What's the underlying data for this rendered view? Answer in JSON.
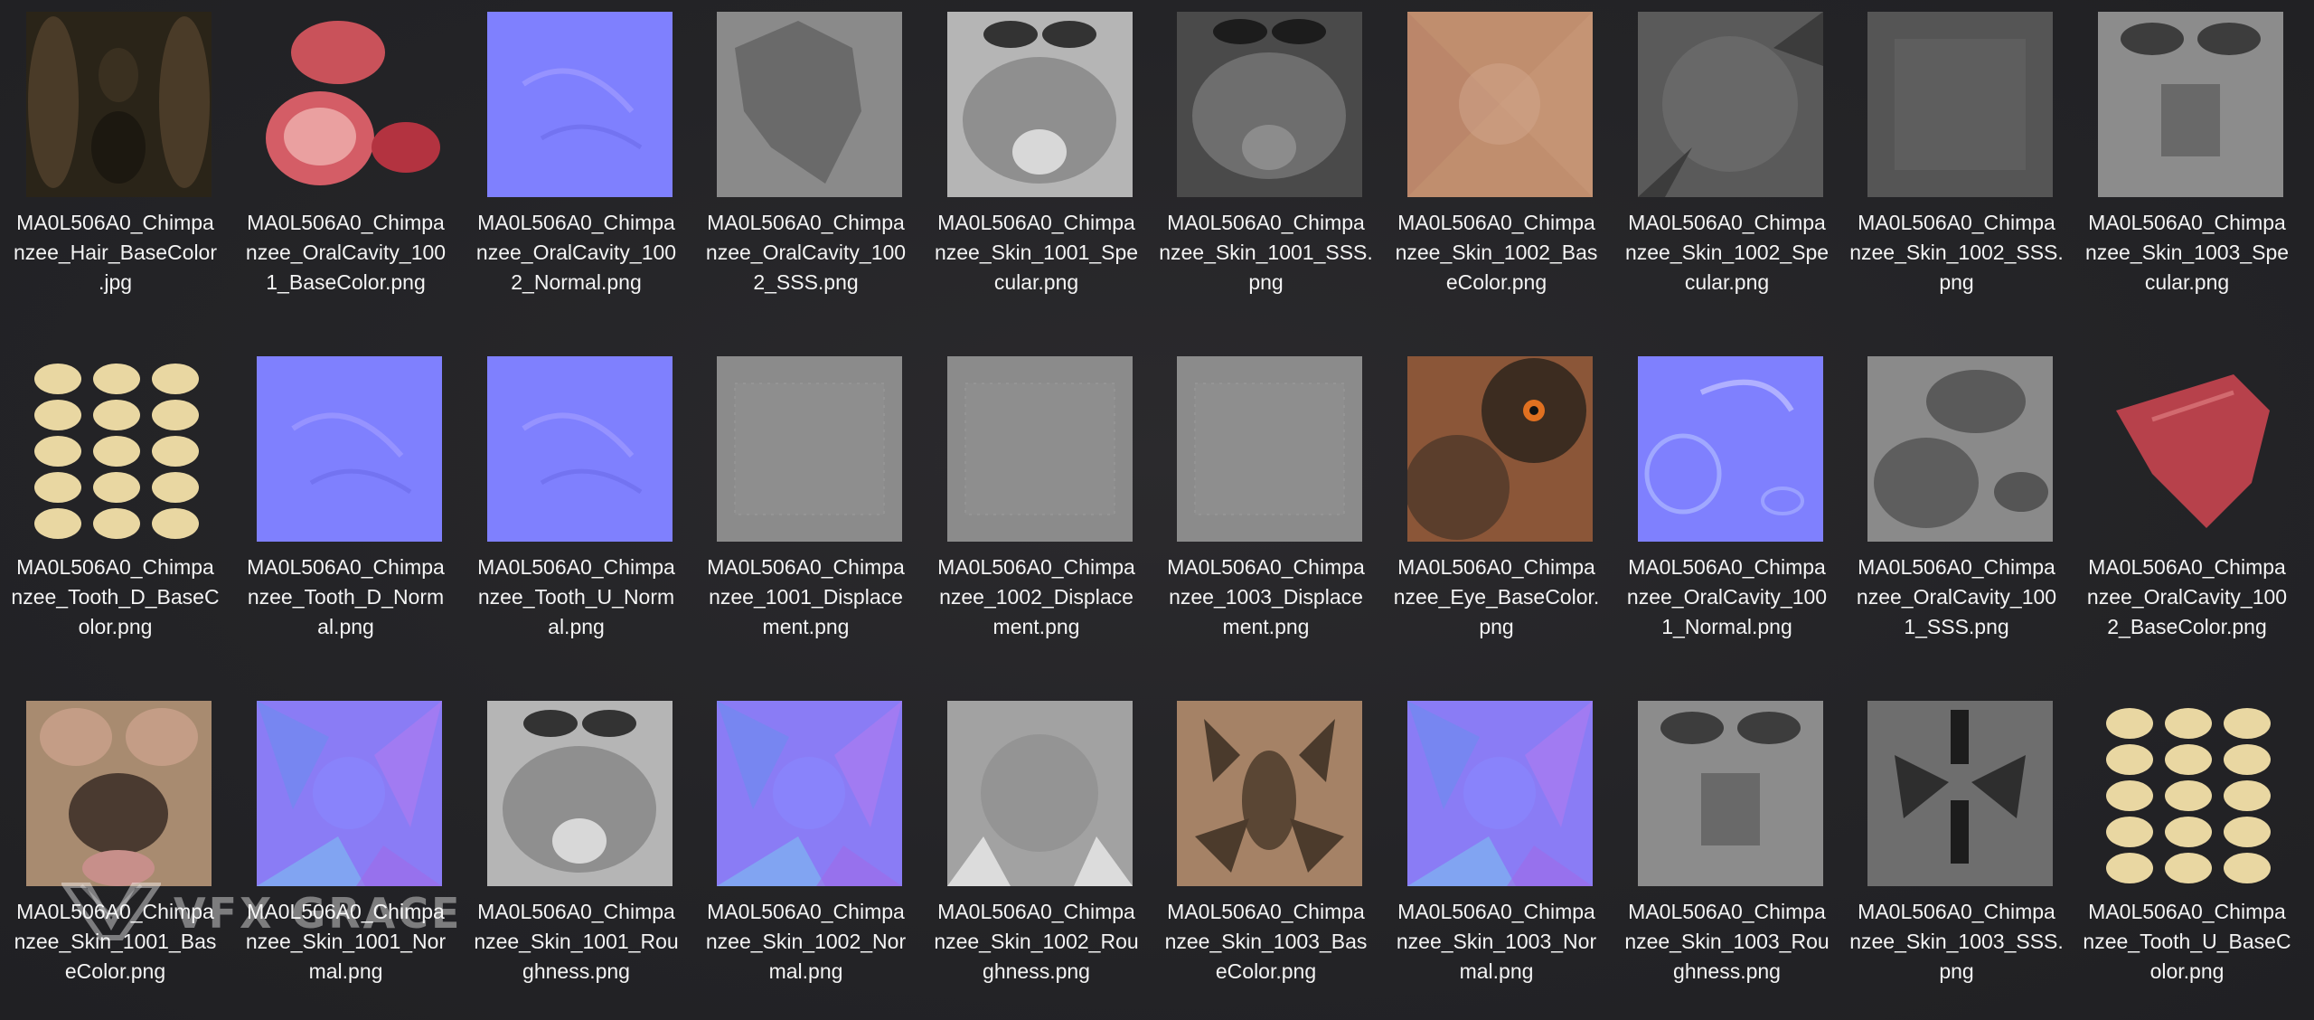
{
  "files": [
    {
      "line1": "MA0L506A0_Chimpa",
      "line2": "nzee_Hair_BaseColor",
      "line3": ".jpg",
      "kind": "hair"
    },
    {
      "line1": "MA0L506A0_Chimpa",
      "line2": "nzee_OralCavity_100",
      "line3": "1_BaseColor.png",
      "kind": "oral-color"
    },
    {
      "line1": "MA0L506A0_Chimpa",
      "line2": "nzee_OralCavity_100",
      "line3": "2_Normal.png",
      "kind": "normal-flat"
    },
    {
      "line1": "MA0L506A0_Chimpa",
      "line2": "nzee_OralCavity_100",
      "line3": "2_SSS.png",
      "kind": "gray-shape"
    },
    {
      "line1": "MA0L506A0_Chimpa",
      "line2": "nzee_Skin_1001_Spe",
      "line3": "cular.png",
      "kind": "face-light"
    },
    {
      "line1": "MA0L506A0_Chimpa",
      "line2": "nzee_Skin_1001_SSS.",
      "line3": "png",
      "kind": "face-dark"
    },
    {
      "line1": "MA0L506A0_Chimpa",
      "line2": "nzee_Skin_1002_Bas",
      "line3": "eColor.png",
      "kind": "skin-tan"
    },
    {
      "line1": "MA0L506A0_Chimpa",
      "line2": "nzee_Skin_1002_Spe",
      "line3": "cular.png",
      "kind": "gray-dark"
    },
    {
      "line1": "MA0L506A0_Chimpa",
      "line2": "nzee_Skin_1002_SSS.",
      "line3": "png",
      "kind": "gray-darker"
    },
    {
      "line1": "MA0L506A0_Chimpa",
      "line2": "nzee_Skin_1003_Spe",
      "line3": "cular.png",
      "kind": "gray-light"
    },
    {
      "line1": "MA0L506A0_Chimpa",
      "line2": "nzee_Tooth_D_BaseC",
      "line3": "olor.png",
      "kind": "teeth"
    },
    {
      "line1": "MA0L506A0_Chimpa",
      "line2": "nzee_Tooth_D_Norm",
      "line3": "al.png",
      "kind": "normal-flat"
    },
    {
      "line1": "MA0L506A0_Chimpa",
      "line2": "nzee_Tooth_U_Norm",
      "line3": "al.png",
      "kind": "normal-flat"
    },
    {
      "line1": "MA0L506A0_Chimpa",
      "line2": "nzee_1001_Displace",
      "line3": "ment.png",
      "kind": "displace"
    },
    {
      "line1": "MA0L506A0_Chimpa",
      "line2": "nzee_1002_Displace",
      "line3": "ment.png",
      "kind": "displace"
    },
    {
      "line1": "MA0L506A0_Chimpa",
      "line2": "nzee_1003_Displace",
      "line3": "ment.png",
      "kind": "displace"
    },
    {
      "line1": "MA0L506A0_Chimpa",
      "line2": "nzee_Eye_BaseColor.",
      "line3": "png",
      "kind": "eye"
    },
    {
      "line1": "MA0L506A0_Chimpa",
      "line2": "nzee_OralCavity_100",
      "line3": "1_Normal.png",
      "kind": "normal-oral"
    },
    {
      "line1": "MA0L506A0_Chimpa",
      "line2": "nzee_OralCavity_100",
      "line3": "1_SSS.png",
      "kind": "gray-oral"
    },
    {
      "line1": "MA0L506A0_Chimpa",
      "line2": "nzee_OralCavity_100",
      "line3": "2_BaseColor.png",
      "kind": "red-leaf"
    },
    {
      "line1": "MA0L506A0_Chimpa",
      "line2": "nzee_Skin_1001_Bas",
      "line3": "eColor.png",
      "kind": "skin-face"
    },
    {
      "line1": "MA0L506A0_Chimpa",
      "line2": "nzee_Skin_1001_Nor",
      "line3": "mal.png",
      "kind": "normal-busy"
    },
    {
      "line1": "MA0L506A0_Chimpa",
      "line2": "nzee_Skin_1001_Rou",
      "line3": "ghness.png",
      "kind": "face-light"
    },
    {
      "line1": "MA0L506A0_Chimpa",
      "line2": "nzee_Skin_1002_Nor",
      "line3": "mal.png",
      "kind": "normal-busy"
    },
    {
      "line1": "MA0L506A0_Chimpa",
      "line2": "nzee_Skin_1002_Rou",
      "line3": "ghness.png",
      "kind": "gray-pale"
    },
    {
      "line1": "MA0L506A0_Chimpa",
      "line2": "nzee_Skin_1003_Bas",
      "line3": "eColor.png",
      "kind": "skin-body"
    },
    {
      "line1": "MA0L506A0_Chimpa",
      "line2": "nzee_Skin_1003_Nor",
      "line3": "mal.png",
      "kind": "normal-busy"
    },
    {
      "line1": "MA0L506A0_Chimpa",
      "line2": "nzee_Skin_1003_Rou",
      "line3": "ghness.png",
      "kind": "gray-light"
    },
    {
      "line1": "MA0L506A0_Chimpa",
      "line2": "nzee_Skin_1003_SSS.",
      "line3": "png",
      "kind": "gray-body"
    },
    {
      "line1": "MA0L506A0_Chimpa",
      "line2": "nzee_Tooth_U_BaseC",
      "line3": "olor.png",
      "kind": "teeth"
    }
  ],
  "watermark": {
    "text": "VFX GRACE",
    "icon": "vfxgrace-logo-icon"
  },
  "colors": {
    "normal": "#7f80fe",
    "text": "#f4f4f4",
    "background": "#262629"
  }
}
